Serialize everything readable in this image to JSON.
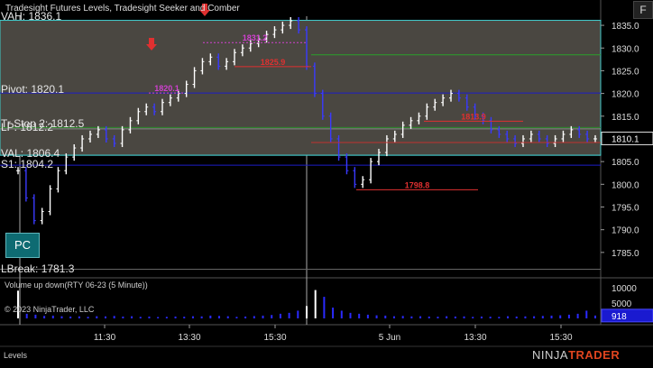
{
  "window": {
    "title": "Tradesight Futures Levels, Tradesight Seeker and Comber",
    "f_button": "F",
    "footer_tab": "Levels",
    "copyright": "© 2023 NinjaTrader, LLC",
    "brand_prefix": "NINJA",
    "brand_suffix": "TRADER",
    "pc_badge": "PC"
  },
  "colors": {
    "background": "#000000",
    "value_area_fill": "#4a4741",
    "value_area_border": "#40c8c8",
    "pivot_line": "#1c1cc8",
    "bar_up": "#ffffff",
    "bar_down": "#3a3aff",
    "label_red": "#e03030",
    "label_magenta": "#d040d0",
    "label_green": "#2aa02a",
    "label_cyan": "#20d0e0",
    "volume_bar": "#2a2aff",
    "volume_white": "#ffffff"
  },
  "levels": [
    {
      "name": "VAH",
      "text": "VAH: 1836.1",
      "value": 1836.1
    },
    {
      "name": "Pivot",
      "text": "Pivot: 1820.1",
      "value": 1820.1
    },
    {
      "name": "TrStop2",
      "text": "Tr Stop 2: 1812.5",
      "value": 1812.5
    },
    {
      "name": "LP",
      "text": "LP: 1812.2",
      "value": 1812.2
    },
    {
      "name": "VAL",
      "text": "VAL: 1806.4",
      "value": 1806.4
    },
    {
      "name": "S1",
      "text": "S1: 1804.2",
      "value": 1804.2
    },
    {
      "name": "LBreak",
      "text": "LBreak: 1781.3",
      "value": 1781.3
    }
  ],
  "annotations": [
    {
      "text": "1831.2",
      "value": 1831.2,
      "color": "magenta"
    },
    {
      "text": "1825.9",
      "value": 1825.9,
      "color": "red"
    },
    {
      "text": "1820.1",
      "value": 1820.1,
      "color": "magenta"
    },
    {
      "text": "1813.9",
      "value": 1813.9,
      "color": "red"
    },
    {
      "text": "1798.8",
      "value": 1798.8,
      "color": "red"
    }
  ],
  "chart_data": {
    "type": "bar",
    "title": "Tradesight Futures Levels, Tradesight Seeker and Comber",
    "instrument": "RTY 06-23 (5 Minute)",
    "ylim": [
      1781,
      1837
    ],
    "y_ticks": [
      1785.0,
      1790.0,
      1795.0,
      1800.0,
      1805.0,
      1810.0,
      1815.0,
      1820.0,
      1825.0,
      1830.0,
      1835.0
    ],
    "y_tick_labels": [
      "1785.0",
      "1790.0",
      "1795.0",
      "1800.0",
      "1805.0",
      "1810.0",
      "1815.0",
      "1820.0",
      "1825.0",
      "1830.0",
      "1835.0"
    ],
    "x_tick_labels": [
      "11:30",
      "13:30",
      "15:30",
      "5 Jun",
      "13:30",
      "15:30"
    ],
    "last_price": "1810.1",
    "price_series": [
      1803,
      1797,
      1792,
      1794,
      1799,
      1803,
      1806,
      1808,
      1810,
      1811,
      1812,
      1810,
      1809,
      1812,
      1814,
      1816,
      1817,
      1816,
      1818,
      1819,
      1820,
      1822,
      1825,
      1827,
      1828,
      1826,
      1827,
      1829,
      1830,
      1831,
      1832,
      1833,
      1834,
      1835,
      1836,
      1834,
      1826,
      1820,
      1815,
      1810,
      1806,
      1803,
      1800,
      1801,
      1805,
      1807,
      1810,
      1811,
      1813,
      1814,
      1815,
      1817,
      1818,
      1819,
      1820,
      1819,
      1817,
      1815,
      1814,
      1812,
      1811,
      1810,
      1809,
      1810,
      1811,
      1810,
      1809,
      1810,
      1811,
      1812,
      1811,
      1810,
      1810
    ],
    "volume_indicator": {
      "title": "Volume up down(RTY 06-23 (5 Minute))",
      "y_tick_labels": [
        "5000",
        "10000"
      ],
      "y_ticks": [
        5000,
        10000
      ],
      "ylim": [
        0,
        12000
      ],
      "last_value": "918",
      "values": [
        9000,
        1500,
        1200,
        800,
        900,
        700,
        600,
        650,
        500,
        700,
        650,
        800,
        600,
        700,
        500,
        600,
        450,
        500,
        600,
        550,
        700,
        650,
        900,
        800,
        700,
        500,
        600,
        750,
        900,
        1100,
        1500,
        1800,
        2500,
        4000,
        9200,
        7000,
        3500,
        2500,
        1800,
        1500,
        1200,
        1000,
        900,
        700,
        800,
        650,
        700,
        600,
        550,
        700,
        600,
        650,
        500,
        600,
        550,
        500,
        700,
        600,
        650,
        700,
        800,
        900,
        1000,
        1200,
        1500,
        2500,
        918
      ]
    }
  }
}
